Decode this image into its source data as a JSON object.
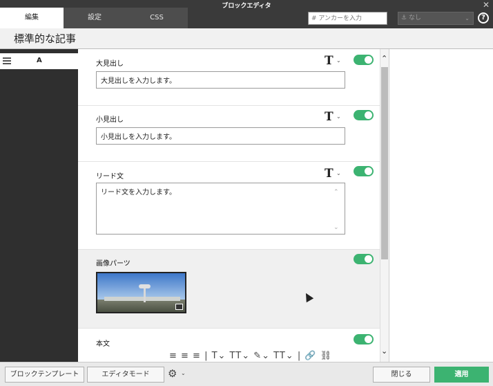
{
  "window": {
    "title": "ブロックエディタ",
    "close_glyph": "✕"
  },
  "tabs": [
    {
      "label": "編集",
      "active": true
    },
    {
      "label": "設定",
      "active": false
    },
    {
      "label": "CSS",
      "active": false
    }
  ],
  "anchor": {
    "placeholder": "# アンカーを入力",
    "select_value": "なし",
    "select_icon": "anchor-icon"
  },
  "help_glyph": "?",
  "page_title": "標準的な記事",
  "sidebar": {
    "items": [
      {
        "label": "A"
      }
    ]
  },
  "blocks": [
    {
      "label": "大見出し",
      "value": "大見出しを入力します。",
      "type_icon": "T",
      "enabled": true
    },
    {
      "label": "小見出し",
      "value": "小見出しを入力します。",
      "type_icon": "T",
      "enabled": true
    },
    {
      "label": "リード文",
      "value": "リード文を入力します。",
      "type_icon": "T",
      "enabled": true
    },
    {
      "label": "画像パーツ",
      "enabled": true,
      "image_alt": "airport-control-tower-photo"
    },
    {
      "label": "本文",
      "enabled": true,
      "toolbar_glyphs": "≡ ≡ ≡ | T⌄ TT⌄ ✎⌄ TT⌄ | 🔗 ⛓"
    }
  ],
  "bottom": {
    "template_button": "ブロックテンプレート",
    "editor_mode_button": "エディタモード",
    "close_button": "閉じる",
    "apply_button": "適用"
  },
  "colors": {
    "accent": "#3cb371",
    "titlebar": "#3a3a3a",
    "sidebar": "#2f2f2f"
  }
}
